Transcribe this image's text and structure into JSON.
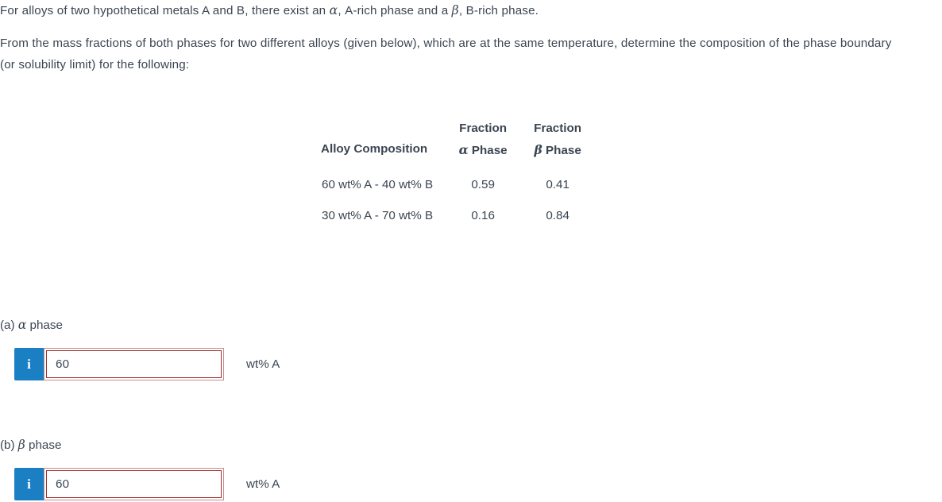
{
  "problem": {
    "intro_line_1_a": "For alloys of two hypothetical metals A and B, there exist an ",
    "intro_alpha": "α",
    "intro_line_1_b": ", A-rich phase and a ",
    "intro_beta": "β",
    "intro_line_1_c": ", B-rich phase.",
    "intro_line_2": "From the mass fractions of both phases for two different alloys (given below), which are at the same temperature, determine the composition of the phase boundary (or solubility limit) for the following:"
  },
  "table": {
    "headers": {
      "composition": "Alloy Composition",
      "alpha_top": "Fraction",
      "alpha_bottom_symbol": "α",
      "alpha_bottom_word": " Phase",
      "beta_top": "Fraction",
      "beta_bottom_symbol": "β",
      "beta_bottom_word": " Phase"
    },
    "rows": [
      {
        "composition": "60 wt% A - 40 wt% B",
        "fraction_alpha": "0.59",
        "fraction_beta": "0.41"
      },
      {
        "composition": "30 wt% A - 70 wt% B",
        "fraction_alpha": "0.16",
        "fraction_beta": "0.84"
      }
    ]
  },
  "answers": {
    "part_a": {
      "label_prefix": "(a) ",
      "label_symbol": "α",
      "label_suffix": " phase",
      "info_icon": "i",
      "value": "60",
      "placeholder": "",
      "unit": "wt% A"
    },
    "part_b": {
      "label_prefix": "(b) ",
      "label_symbol": "β",
      "label_suffix": " phase",
      "info_icon": "i",
      "value": "60",
      "placeholder": "",
      "unit": "wt% A"
    }
  },
  "colors": {
    "text": "#3b4552",
    "info_button": "#1b7fc4",
    "input_border_inner": "#9e2a2b",
    "input_border_outer": "#c98c8c",
    "background": "#ffffff"
  }
}
